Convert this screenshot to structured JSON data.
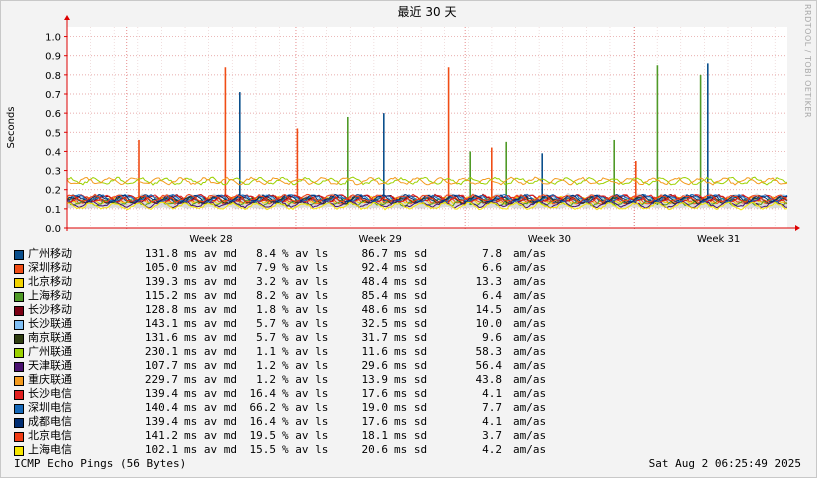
{
  "chart_data": {
    "type": "line",
    "title": "最近 30 天",
    "ylabel": "Seconds",
    "ylim": [
      0,
      1.05
    ],
    "yticks": [
      "0.0",
      "0.1",
      "0.2",
      "0.3",
      "0.4",
      "0.5",
      "0.6",
      "0.7",
      "0.8",
      "0.9",
      "1.0"
    ],
    "xticks": [
      "Week 28",
      "Week 29",
      "Week 30",
      "Week 31"
    ],
    "series": [
      {
        "name": "广州移动",
        "color": "#0b4f8c",
        "baseline": 0.13,
        "spikes": [
          [
            0.24,
            0.71
          ],
          [
            0.44,
            0.6
          ],
          [
            0.66,
            0.39
          ],
          [
            0.89,
            0.86
          ]
        ]
      },
      {
        "name": "深圳移动",
        "color": "#f04d15",
        "baseline": 0.13,
        "spikes": [
          [
            0.1,
            0.46
          ],
          [
            0.22,
            0.84
          ],
          [
            0.32,
            0.52
          ],
          [
            0.53,
            0.84
          ],
          [
            0.59,
            0.42
          ],
          [
            0.79,
            0.35
          ]
        ]
      },
      {
        "name": "北京移动",
        "color": "#f2d300",
        "baseline": 0.13,
        "spikes": []
      },
      {
        "name": "上海移动",
        "color": "#4f9a27",
        "baseline": 0.12,
        "spikes": [
          [
            0.39,
            0.58
          ],
          [
            0.56,
            0.4
          ],
          [
            0.61,
            0.45
          ],
          [
            0.76,
            0.46
          ],
          [
            0.82,
            0.85
          ],
          [
            0.88,
            0.8
          ]
        ]
      },
      {
        "name": "长沙移动",
        "color": "#7a0014",
        "baseline": 0.14,
        "spikes": []
      },
      {
        "name": "长沙联通",
        "color": "#80bff5",
        "baseline": 0.14,
        "spikes": []
      },
      {
        "name": "南京联通",
        "color": "#2e3d10",
        "baseline": 0.13,
        "spikes": []
      },
      {
        "name": "广州联通",
        "color": "#9bd100",
        "baseline": 0.23,
        "spikes": []
      },
      {
        "name": "天津联通",
        "color": "#4a1170",
        "baseline": 0.11,
        "spikes": []
      },
      {
        "name": "重庆联通",
        "color": "#f39a1e",
        "baseline": 0.23,
        "spikes": []
      },
      {
        "name": "长沙电信",
        "color": "#e01f1f",
        "baseline": 0.14,
        "spikes": []
      },
      {
        "name": "深圳电信",
        "color": "#1568b8",
        "baseline": 0.14,
        "spikes": []
      },
      {
        "name": "成都电信",
        "color": "#002d72",
        "baseline": 0.14,
        "spikes": []
      },
      {
        "name": "北京电信",
        "color": "#f03c15",
        "baseline": 0.14,
        "spikes": []
      },
      {
        "name": "上海电信",
        "color": "#f7e600",
        "baseline": 0.1,
        "spikes": []
      }
    ]
  },
  "legend": [
    {
      "name": "广州移动",
      "color": "#0b4f8c",
      "md": "131.8",
      "ls": "8.4",
      "sd": "86.7",
      "am": "7.8"
    },
    {
      "name": "深圳移动",
      "color": "#f04d15",
      "md": "105.0",
      "ls": "7.9",
      "sd": "92.4",
      "am": "6.6"
    },
    {
      "name": "北京移动",
      "color": "#f2d300",
      "md": "139.3",
      "ls": "3.2",
      "sd": "48.4",
      "am": "13.3"
    },
    {
      "name": "上海移动",
      "color": "#4f9a27",
      "md": "115.2",
      "ls": "8.2",
      "sd": "85.4",
      "am": "6.4"
    },
    {
      "name": "长沙移动",
      "color": "#7a0014",
      "md": "128.8",
      "ls": "1.8",
      "sd": "48.6",
      "am": "14.5"
    },
    {
      "name": "长沙联通",
      "color": "#80bff5",
      "md": "143.1",
      "ls": "5.7",
      "sd": "32.5",
      "am": "10.0"
    },
    {
      "name": "南京联通",
      "color": "#2e3d10",
      "md": "131.6",
      "ls": "5.7",
      "sd": "31.7",
      "am": "9.6"
    },
    {
      "name": "广州联通",
      "color": "#9bd100",
      "md": "230.1",
      "ls": "1.1",
      "sd": "11.6",
      "am": "58.3"
    },
    {
      "name": "天津联通",
      "color": "#4a1170",
      "md": "107.7",
      "ls": "1.2",
      "sd": "29.6",
      "am": "56.4"
    },
    {
      "name": "重庆联通",
      "color": "#f39a1e",
      "md": "229.7",
      "ls": "1.2",
      "sd": "13.9",
      "am": "43.8"
    },
    {
      "name": "长沙电信",
      "color": "#e01f1f",
      "md": "139.4",
      "ls": "16.4",
      "sd": "17.6",
      "am": "4.1"
    },
    {
      "name": "深圳电信",
      "color": "#1568b8",
      "md": "140.4",
      "ls": "66.2",
      "sd": "19.0",
      "am": "7.7"
    },
    {
      "name": "成都电信",
      "color": "#002d72",
      "md": "139.4",
      "ls": "16.4",
      "sd": "17.6",
      "am": "4.1"
    },
    {
      "name": "北京电信",
      "color": "#f03c15",
      "md": "141.2",
      "ls": "19.5",
      "sd": "18.1",
      "am": "3.7"
    },
    {
      "name": "上海电信",
      "color": "#f7e600",
      "md": "102.1",
      "ls": "15.5",
      "sd": "20.6",
      "am": "4.2"
    }
  ],
  "units": {
    "md": "ms av md",
    "ls": "% av ls",
    "sd": "ms sd",
    "am": "am/as"
  },
  "footer": {
    "left": "ICMP Echo Pings (56 Bytes)",
    "right": "Sat Aug  2 06:25:49 2025"
  },
  "watermark": "RRDTOOL / TOBI OETIKER"
}
